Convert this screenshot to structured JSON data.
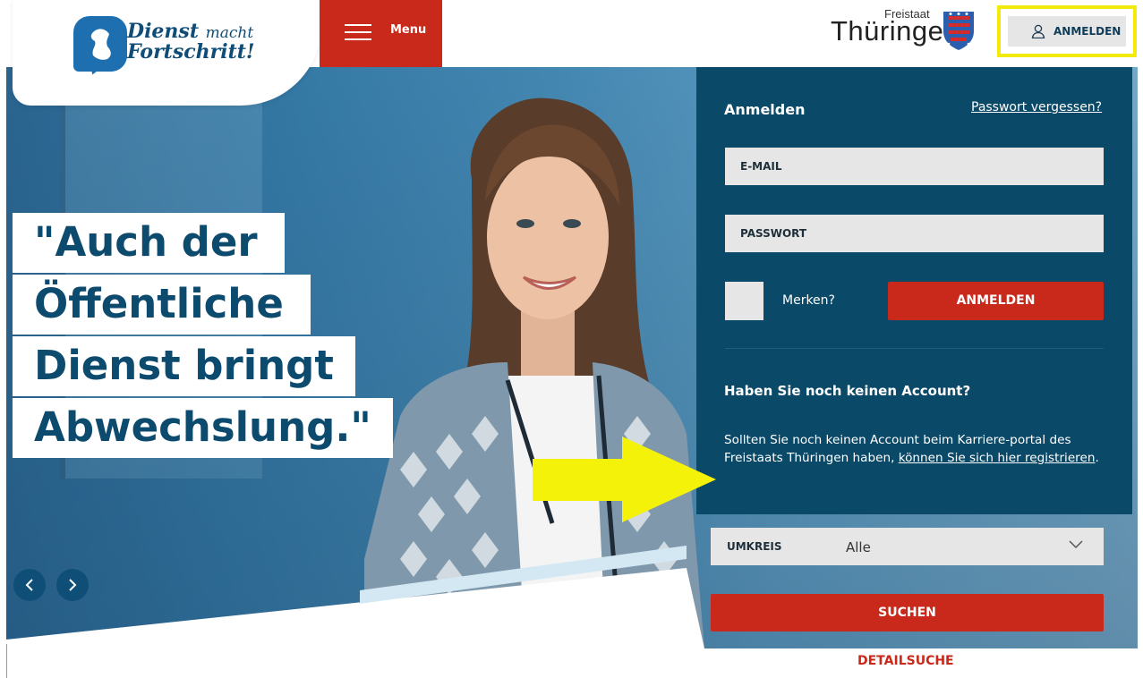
{
  "header": {
    "logo_line1_bold": "Dienst",
    "logo_line1_light": "macht",
    "logo_line2": "Fortschritt!",
    "menu_label": "Menu",
    "state_small": "Freistaat",
    "state_big": "Thüringen",
    "login_label": "ANMELDEN"
  },
  "hero": {
    "quote_lines": [
      "\"Auch der",
      "Öffentliche",
      "Dienst bringt",
      "Abwechslung.\""
    ]
  },
  "login_panel": {
    "title": "Anmelden",
    "forgot_password": "Passwort vergessen?",
    "email_placeholder": "E-MAIL",
    "password_placeholder": "PASSWORT",
    "remember_label": "Merken?",
    "submit_label": "ANMELDEN",
    "no_account_heading": "Haben Sie noch keinen Account?",
    "no_account_text": "Sollten Sie noch keinen Account beim Karriere-portal des Freistaats Thüringen haben, ",
    "register_link": "können Sie sich hier registrieren",
    "register_suffix": "."
  },
  "search": {
    "umkreis_label": "UMKREIS",
    "umkreis_value": "Alle",
    "search_button": "SUCHEN",
    "detail_search": "DETAILSUCHE"
  },
  "colors": {
    "brand_red": "#c8291b",
    "panel_blue": "#0b4968",
    "highlight_yellow": "#f2ea0a"
  }
}
